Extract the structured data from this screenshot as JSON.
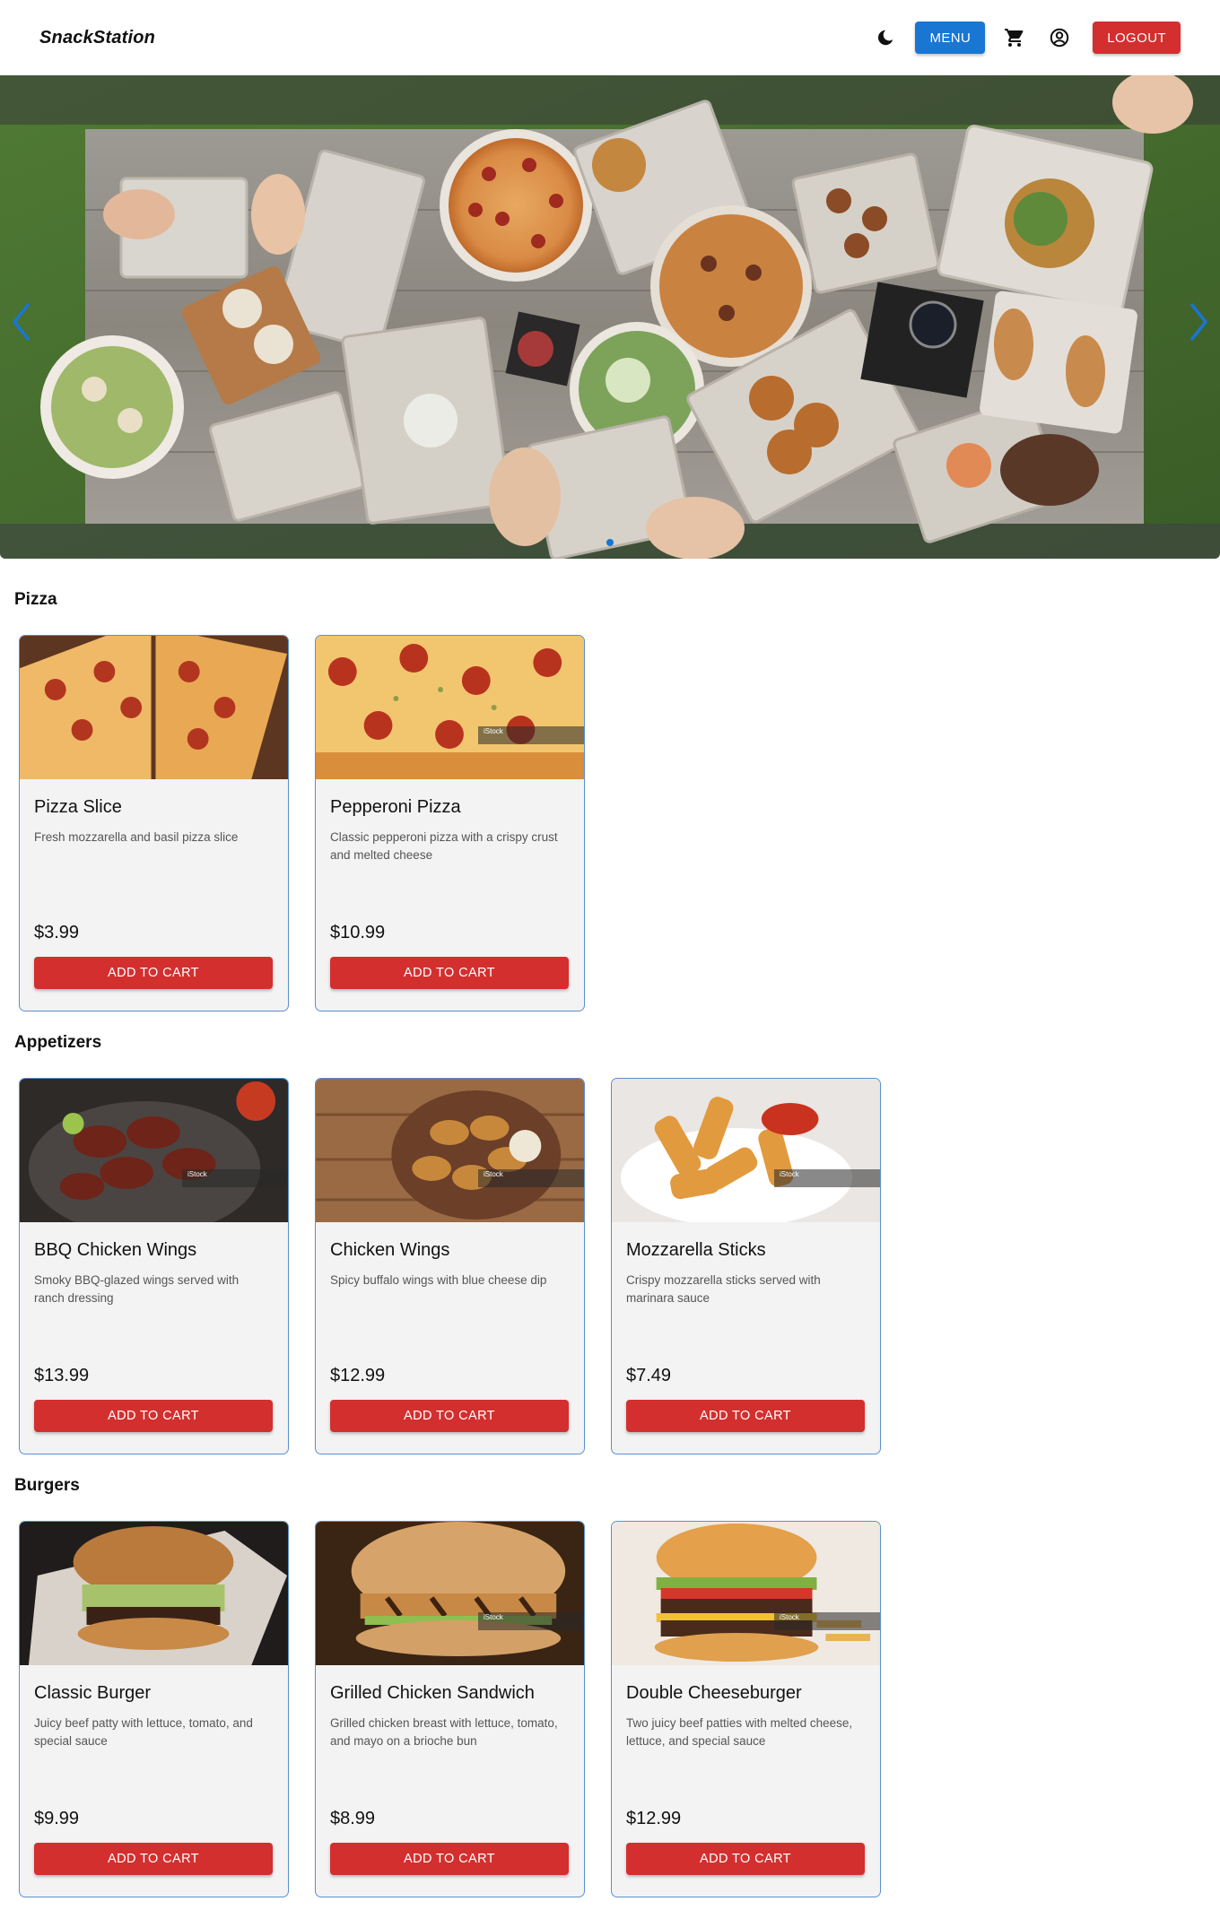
{
  "header": {
    "brand": "SnackStation",
    "menu_label": "MENU",
    "logout_label": "LOGOUT"
  },
  "sections": [
    {
      "title": "Pizza",
      "items": [
        {
          "name": "Pizza Slice",
          "description": "Fresh mozzarella and basil pizza slice",
          "price": "$3.99",
          "button": "ADD TO CART",
          "watermark": ""
        },
        {
          "name": "Pepperoni Pizza",
          "description": "Classic pepperoni pizza with a crispy crust and melted cheese",
          "price": "$10.99",
          "button": "ADD TO CART",
          "watermark": "iStock"
        }
      ]
    },
    {
      "title": "Appetizers",
      "items": [
        {
          "name": "BBQ Chicken Wings",
          "description": "Smoky BBQ-glazed wings served with ranch dressing",
          "price": "$13.99",
          "button": "ADD TO CART",
          "watermark": "iStock"
        },
        {
          "name": "Chicken Wings",
          "description": "Spicy buffalo wings with blue cheese dip",
          "price": "$12.99",
          "button": "ADD TO CART",
          "watermark": "iStock"
        },
        {
          "name": "Mozzarella Sticks",
          "description": "Crispy mozzarella sticks served with marinara sauce",
          "price": "$7.49",
          "button": "ADD TO CART",
          "watermark": "iStock"
        }
      ]
    },
    {
      "title": "Burgers",
      "items": [
        {
          "name": "Classic Burger",
          "description": "Juicy beef patty with lettuce, tomato, and special sauce",
          "price": "$9.99",
          "button": "ADD TO CART",
          "watermark": ""
        },
        {
          "name": "Grilled Chicken Sandwich",
          "description": "Grilled chicken breast with lettuce, tomato, and mayo on a brioche bun",
          "price": "$8.99",
          "button": "ADD TO CART",
          "watermark": "iStock"
        },
        {
          "name": "Double Cheeseburger",
          "description": "Two juicy beef patties with melted cheese, lettuce, and special sauce",
          "price": "$12.99",
          "button": "ADD TO CART",
          "watermark": "iStock"
        }
      ]
    }
  ],
  "colors": {
    "primary": "#1976d2",
    "danger": "#d32f2f",
    "card_border": "#5b8fd0",
    "card_bg": "#f3f3f4"
  },
  "icons": {
    "theme": "moon-icon",
    "cart": "cart-icon",
    "account": "account-circle-icon",
    "prev": "chevron-left-icon",
    "next": "chevron-right-icon"
  }
}
